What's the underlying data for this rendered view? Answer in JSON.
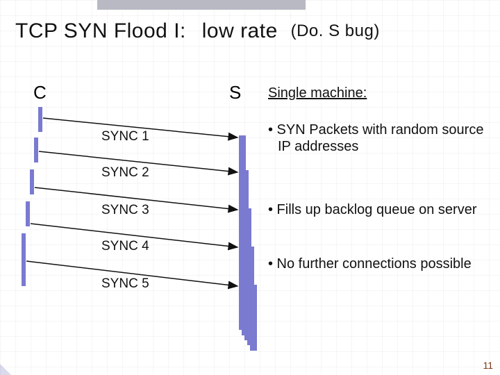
{
  "title": {
    "part1": "TCP SYN Flood I:",
    "part2": "low rate",
    "part3": "(Do. S bug)"
  },
  "labels": {
    "client": "C",
    "server": "S"
  },
  "syn_labels": [
    "SYNC 1",
    "SYNC 2",
    "SYNC 3",
    "SYNC 4",
    "SYNC 5"
  ],
  "right": {
    "heading": "Single machine:",
    "bullets": [
      "• SYN Packets with random source IP addresses",
      "• Fills up backlog queue on server",
      "• No further connections possible"
    ]
  },
  "page": "11",
  "colors": {
    "bar": "#7a7ad1"
  }
}
